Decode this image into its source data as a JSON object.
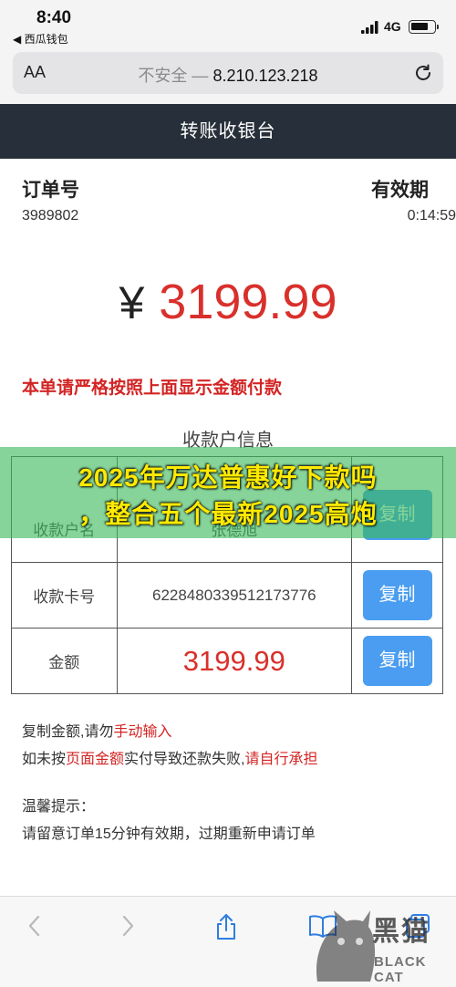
{
  "status_bar": {
    "time": "8:40",
    "back_app": "◀ 西瓜钱包",
    "network": "4G"
  },
  "browser": {
    "aa_label": "AA",
    "url_prefix": "不安全 — ",
    "url_host": "8.210.123.218"
  },
  "page": {
    "header_title": "转账收银台",
    "order_label": "订单号",
    "order_number": "3989802",
    "expiry_label": "有效期",
    "countdown": "0:14:59",
    "currency_symbol": "¥",
    "amount": "3199.99",
    "warning": "本单请严格按照上面显示金额付款",
    "info_title": "收款户信息"
  },
  "info_table": {
    "rows": [
      {
        "label": "收款户名",
        "value": "张德旭",
        "action": "复制"
      },
      {
        "label": "收款卡号",
        "value": "6228480339512173776",
        "action": "复制"
      },
      {
        "label": "金额",
        "value": "3199.99",
        "action": "复制"
      }
    ]
  },
  "overlay": {
    "line1": "2025年万达普惠好下款吗",
    "line2": "，整合五个最新2025高炮"
  },
  "notes": {
    "line1_a": "复制金额,请勿",
    "line1_b": "手动输入",
    "line2_a": "如未按",
    "line2_b": "页面金额",
    "line2_c": "实付导致还款失败,",
    "line2_d": "请自行承担",
    "tips_title": "温馨提示：",
    "tips_body": "请留意订单15分钟有效期，过期重新申请订单"
  },
  "watermark": {
    "title": "黑猫",
    "subtitle": "BLACK CAT"
  },
  "colors": {
    "header_bg": "#27303a",
    "amount_red": "#d9302b",
    "button_blue": "#4a9df0",
    "overlay_green": "#3cb95a",
    "overlay_text": "#ffea00"
  },
  "icons": {
    "status": [
      "signal-icon",
      "battery-icon"
    ],
    "browser": [
      "reload-icon"
    ],
    "toolbar": [
      "back-icon",
      "forward-icon",
      "share-icon",
      "bookmarks-icon",
      "tabs-icon"
    ]
  },
  "battery_level": 0.75
}
